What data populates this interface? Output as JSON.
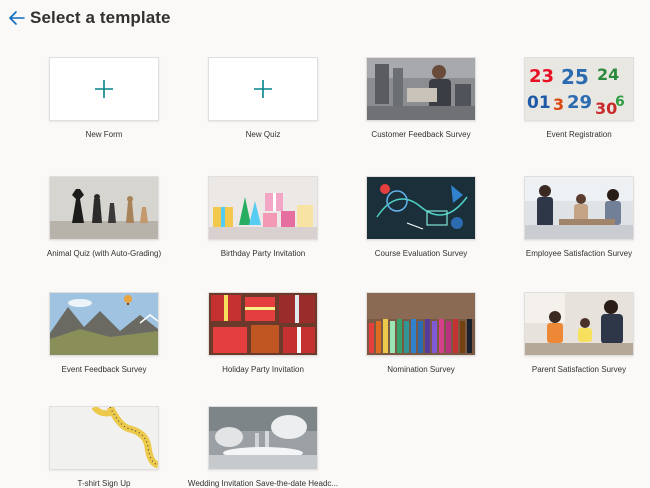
{
  "header": {
    "title": "Select a template",
    "back_icon": "arrow-left-icon"
  },
  "colors": {
    "accent": "#038387",
    "background": "#faf9f8",
    "text": "#323130"
  },
  "templates": [
    {
      "label": "New Form",
      "kind": "blank"
    },
    {
      "label": "New Quiz",
      "kind": "blank"
    },
    {
      "label": "Customer Feedback Survey",
      "kind": "image",
      "image": "office-meeting"
    },
    {
      "label": "Event Registration",
      "kind": "image",
      "image": "colorful-numbers"
    },
    {
      "label": "Animal Quiz (with Auto-Grading)",
      "kind": "image",
      "image": "chess-pieces"
    },
    {
      "label": "Birthday Party Invitation",
      "kind": "image",
      "image": "party-gifts"
    },
    {
      "label": "Course Evaluation Survey",
      "kind": "image",
      "image": "chalkboard-sketch"
    },
    {
      "label": "Employee Satisfaction Survey",
      "kind": "image",
      "image": "office-team"
    },
    {
      "label": "Event Feedback Survey",
      "kind": "image",
      "image": "mountain-balloon"
    },
    {
      "label": "Holiday Party Invitation",
      "kind": "image",
      "image": "wrapped-presents"
    },
    {
      "label": "Nomination Survey",
      "kind": "image",
      "image": "colored-pencils"
    },
    {
      "label": "Parent Satisfaction Survey",
      "kind": "image",
      "image": "family-kitchen"
    },
    {
      "label": "T-shirt Sign Up",
      "kind": "image",
      "image": "measuring-tape"
    },
    {
      "label": "Wedding Invitation Save-the-date Headc...",
      "kind": "image",
      "image": "wedding-table"
    }
  ]
}
